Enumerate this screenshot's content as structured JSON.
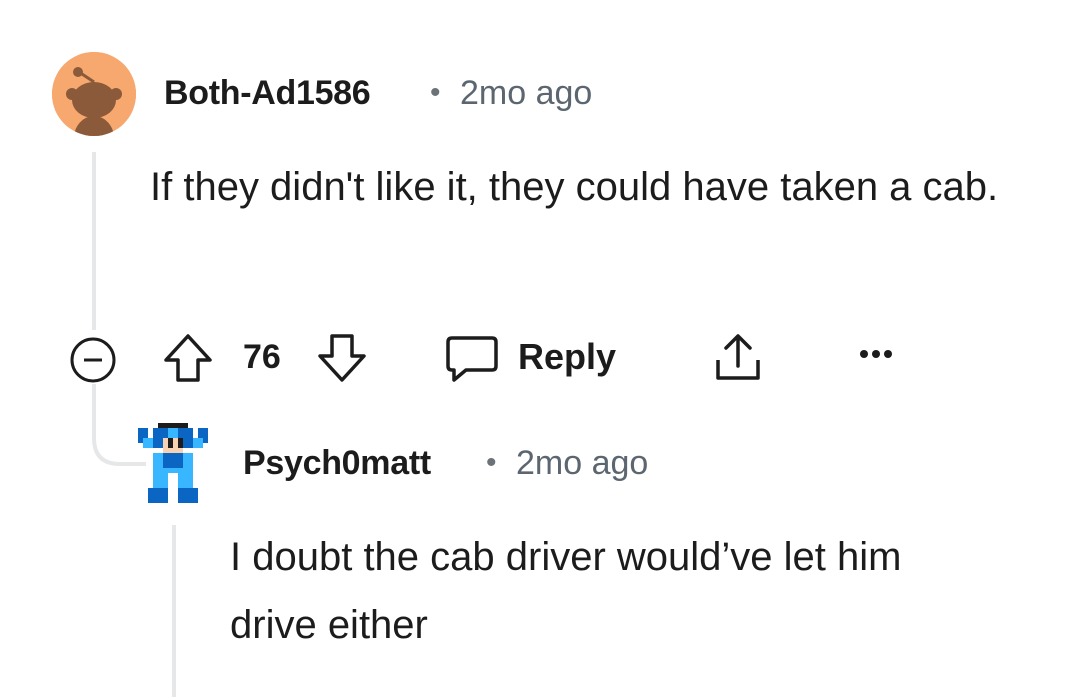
{
  "comments": [
    {
      "username": "Both-Ad1586",
      "separator": "•",
      "time": "2mo ago",
      "body": "If they didn't like it, they could have taken a cab.",
      "avatar": "reddit-snoo-avatar-icon",
      "actions": {
        "score": "76",
        "reply_label": "Reply"
      }
    },
    {
      "username": "Psych0matt",
      "separator": "•",
      "time": "2mo ago",
      "body": "I doubt the cab driver would’ve let him drive either",
      "avatar": "megaman-avatar-icon"
    }
  ],
  "colors": {
    "avatar_orange": "#f7a86e",
    "thread_line": "#e5e7e9",
    "meta_gray": "#5c6670"
  }
}
